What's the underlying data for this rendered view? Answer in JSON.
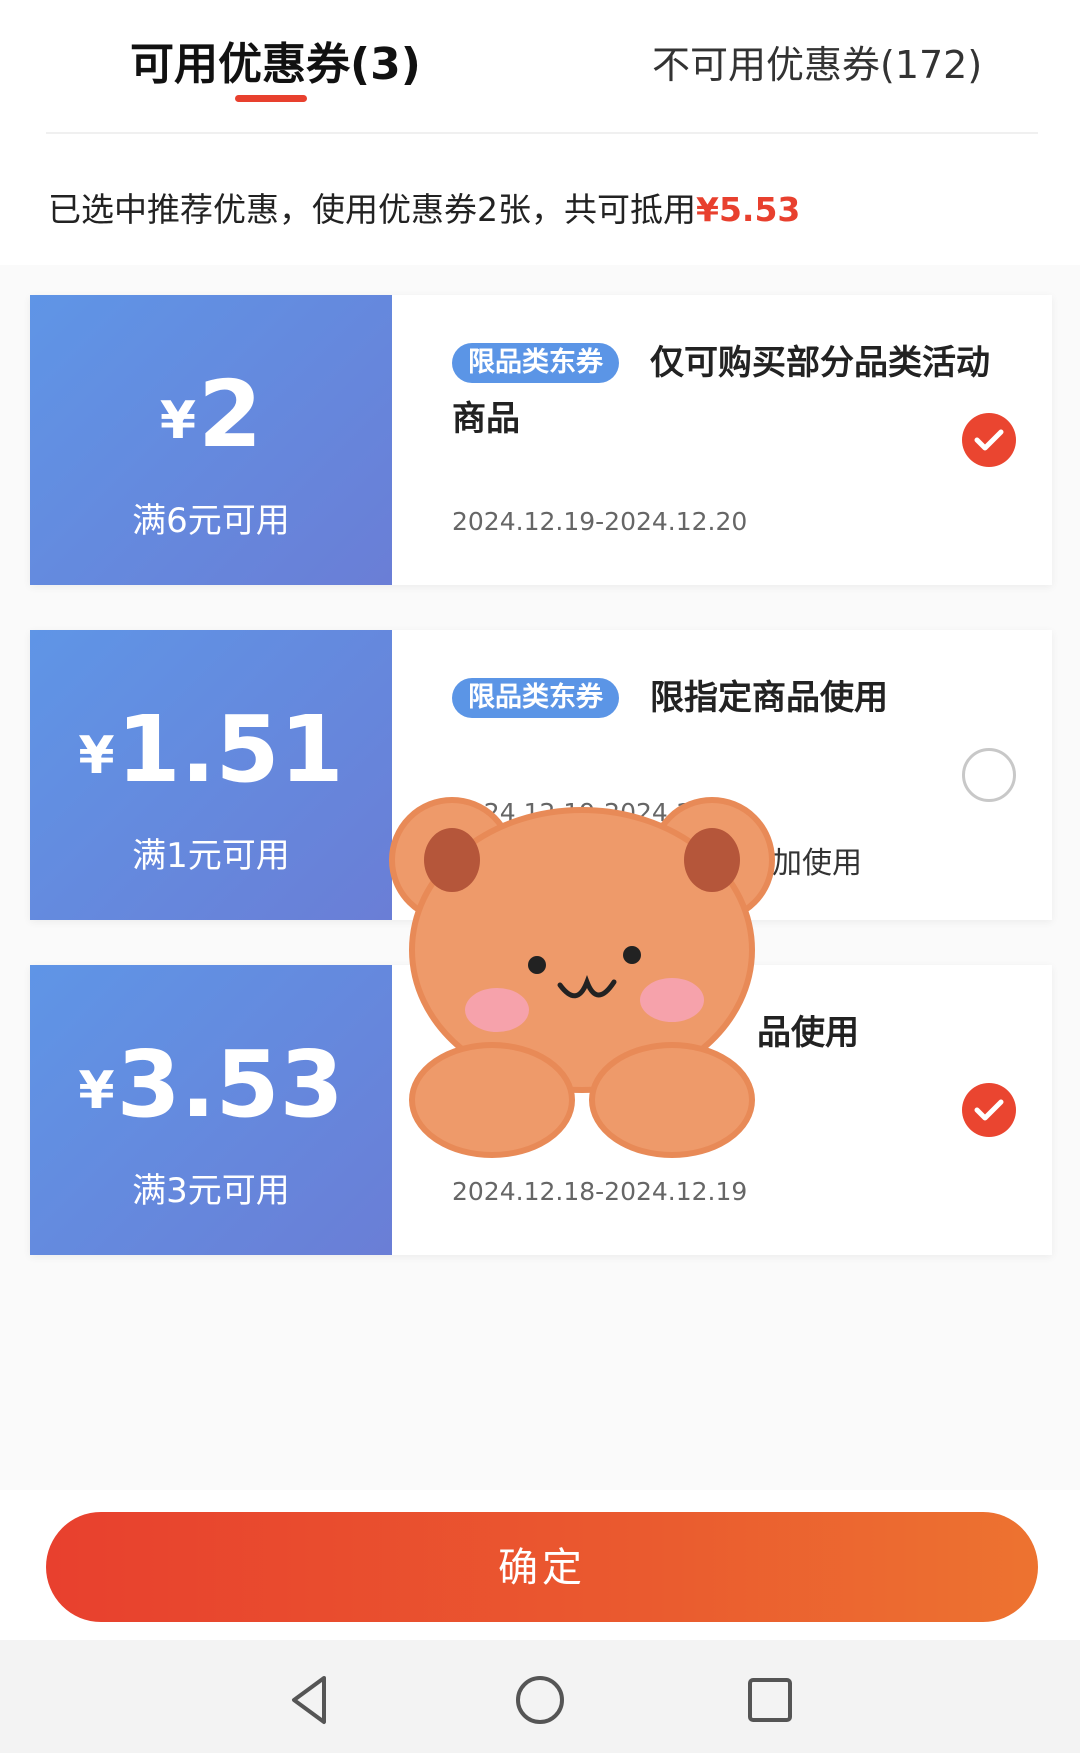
{
  "tabs": {
    "available": "可用优惠券(3)",
    "unavailable": "不可用优惠券(172)"
  },
  "summary": {
    "text": "已选中推荐优惠，使用优惠券2张，共可抵用",
    "amount": "¥5.53"
  },
  "coupons": [
    {
      "currency": "¥",
      "amount": "2",
      "condition": "满6元可用",
      "badge": "限品类东券",
      "title": "仅可购买部分品类活动商品",
      "date": "2024.12.19-2024.12.20",
      "note": "",
      "selected": true
    },
    {
      "currency": "¥",
      "amount": "1.51",
      "condition": "满1元可用",
      "badge": "限品类东券",
      "title": "限指定商品使用",
      "date": "2024.12.19-2024.12",
      "note": "加使用",
      "selected": false
    },
    {
      "currency": "¥",
      "amount": "3.53",
      "condition": "满3元可用",
      "badge": "",
      "title": "品使用",
      "date": "2024.12.18-2024.12.19",
      "note": "",
      "selected": true
    }
  ],
  "confirm_label": "确定",
  "colors": {
    "accent": "#e8402e",
    "coupon_blue": "#5f95e6",
    "badge_blue": "#5b95e6"
  },
  "icons": {
    "back": "back-triangle-icon",
    "home": "home-circle-icon",
    "recents": "recents-square-icon",
    "check": "check-icon"
  }
}
